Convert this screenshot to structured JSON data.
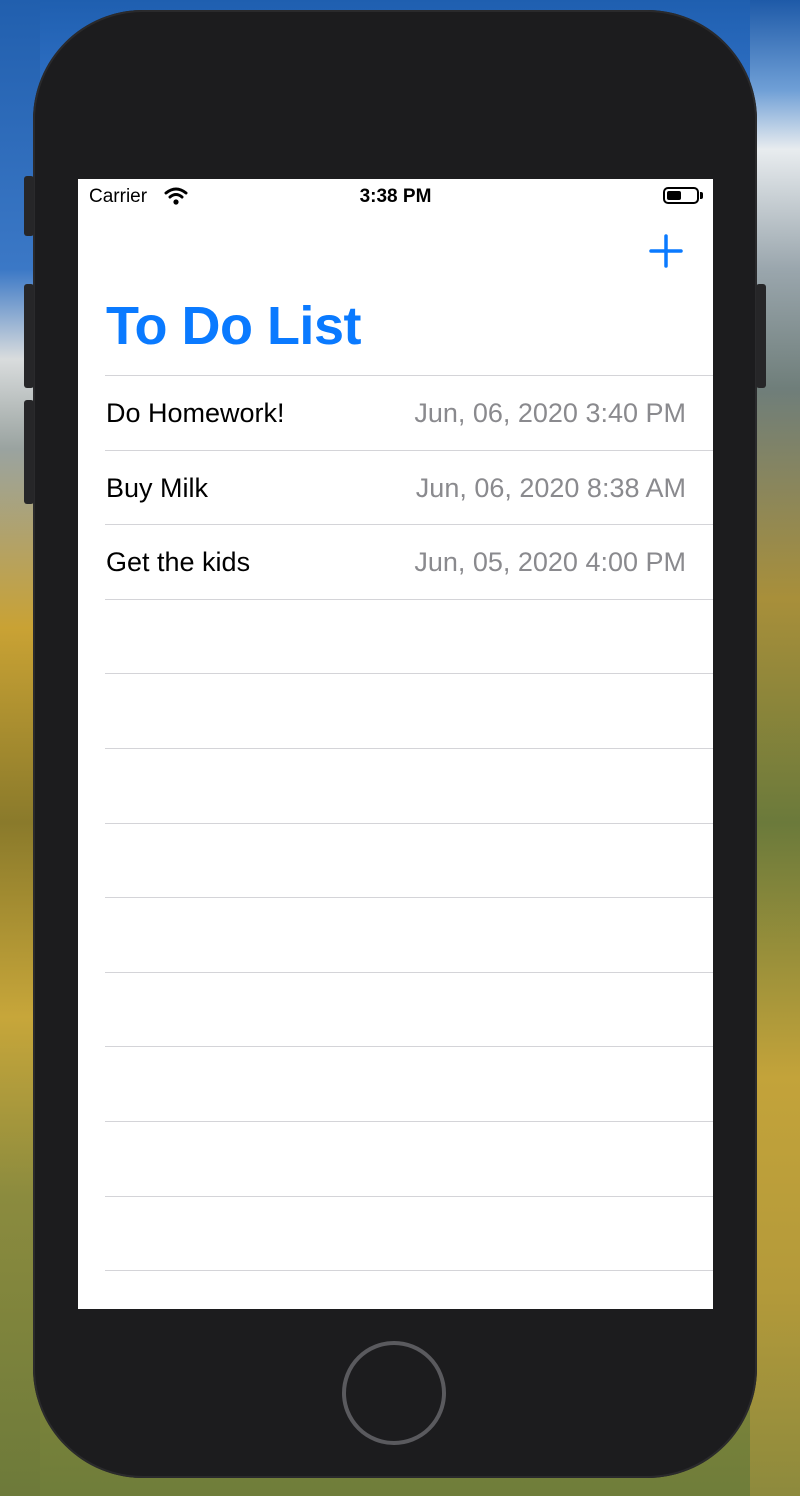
{
  "status_bar": {
    "carrier": "Carrier",
    "time": "3:38 PM",
    "wifi_icon": "wifi-icon",
    "battery_icon": "battery-icon"
  },
  "nav": {
    "add_icon": "plus-icon",
    "title": "To Do List",
    "accent_color": "#0a7aff"
  },
  "todos": [
    {
      "title": "Do Homework!",
      "date": "Jun, 06, 2020 3:40 PM"
    },
    {
      "title": "Buy Milk",
      "date": "Jun, 06, 2020 8:38 AM"
    },
    {
      "title": "Get the kids",
      "date": "Jun, 05, 2020 4:00 PM"
    },
    {
      "title": "",
      "date": ""
    },
    {
      "title": "",
      "date": ""
    },
    {
      "title": "",
      "date": ""
    },
    {
      "title": "",
      "date": ""
    },
    {
      "title": "",
      "date": ""
    },
    {
      "title": "",
      "date": ""
    },
    {
      "title": "",
      "date": ""
    },
    {
      "title": "",
      "date": ""
    },
    {
      "title": "",
      "date": ""
    }
  ]
}
